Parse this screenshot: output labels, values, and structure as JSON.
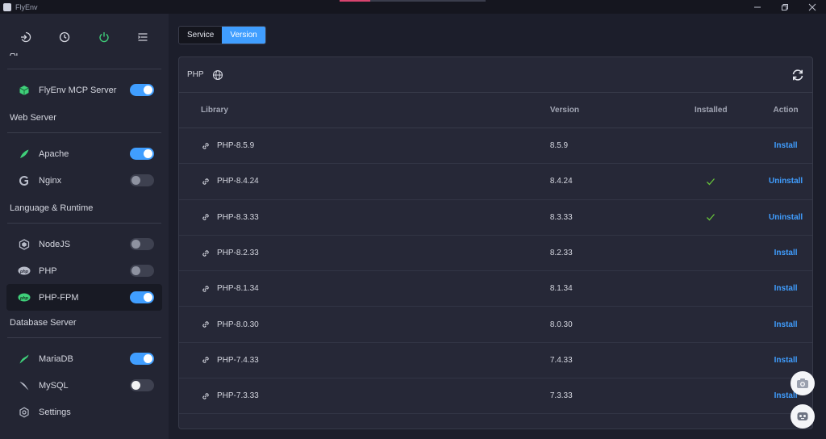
{
  "window": {
    "title": "FlyEnv"
  },
  "sidebar": {
    "partial_label": "AI",
    "sections": {
      "web": "Web Server",
      "lang": "Language & Runtime",
      "db": "Database Server"
    },
    "items": {
      "mcp": {
        "label": "FlyEnv MCP Server",
        "on": true
      },
      "apache": {
        "label": "Apache",
        "on": true
      },
      "nginx": {
        "label": "Nginx",
        "on": false
      },
      "nodejs": {
        "label": "NodeJS",
        "on": false
      },
      "php": {
        "label": "PHP",
        "on": false
      },
      "phpfpm": {
        "label": "PHP-FPM",
        "on": true
      },
      "mariadb": {
        "label": "MariaDB",
        "on": true
      },
      "mysql": {
        "label": "MySQL",
        "on": false
      },
      "settings": {
        "label": "Settings"
      }
    }
  },
  "tabs": {
    "service": "Service",
    "version": "Version",
    "active": "Version"
  },
  "panel": {
    "title": "PHP",
    "columns": {
      "library": "Library",
      "version": "Version",
      "installed": "Installed",
      "action": "Action"
    },
    "rows": [
      {
        "library": "PHP-8.5.9",
        "version": "8.5.9",
        "installed": false,
        "action": "Install"
      },
      {
        "library": "PHP-8.4.24",
        "version": "8.4.24",
        "installed": true,
        "action": "Uninstall"
      },
      {
        "library": "PHP-8.3.33",
        "version": "8.3.33",
        "installed": true,
        "action": "Uninstall"
      },
      {
        "library": "PHP-8.2.33",
        "version": "8.2.33",
        "installed": false,
        "action": "Install"
      },
      {
        "library": "PHP-8.1.34",
        "version": "8.1.34",
        "installed": false,
        "action": "Install"
      },
      {
        "library": "PHP-8.0.30",
        "version": "8.0.30",
        "installed": false,
        "action": "Install"
      },
      {
        "library": "PHP-7.4.33",
        "version": "7.4.33",
        "installed": false,
        "action": "Install"
      },
      {
        "library": "PHP-7.3.33",
        "version": "7.3.33",
        "installed": false,
        "action": "Install"
      }
    ]
  },
  "colors": {
    "accent": "#409eff",
    "success": "#67c23a",
    "green_icon": "#3fd07a"
  }
}
